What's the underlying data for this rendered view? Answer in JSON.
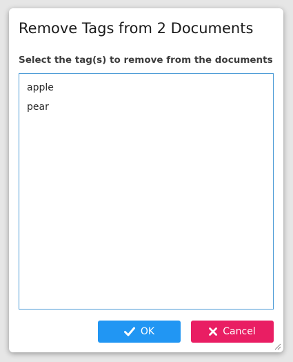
{
  "dialog": {
    "title": "Remove Tags from 2 Documents",
    "field_label": "Select the tag(s) to remove from the documents",
    "tags": [
      "apple",
      "pear"
    ],
    "ok_label": "OK",
    "cancel_label": "Cancel",
    "ok_icon": "check-icon",
    "cancel_icon": "close-icon",
    "colors": {
      "ok_button": "#2196f3",
      "cancel_button": "#e91e63",
      "list_border": "#4a9ad6"
    }
  }
}
